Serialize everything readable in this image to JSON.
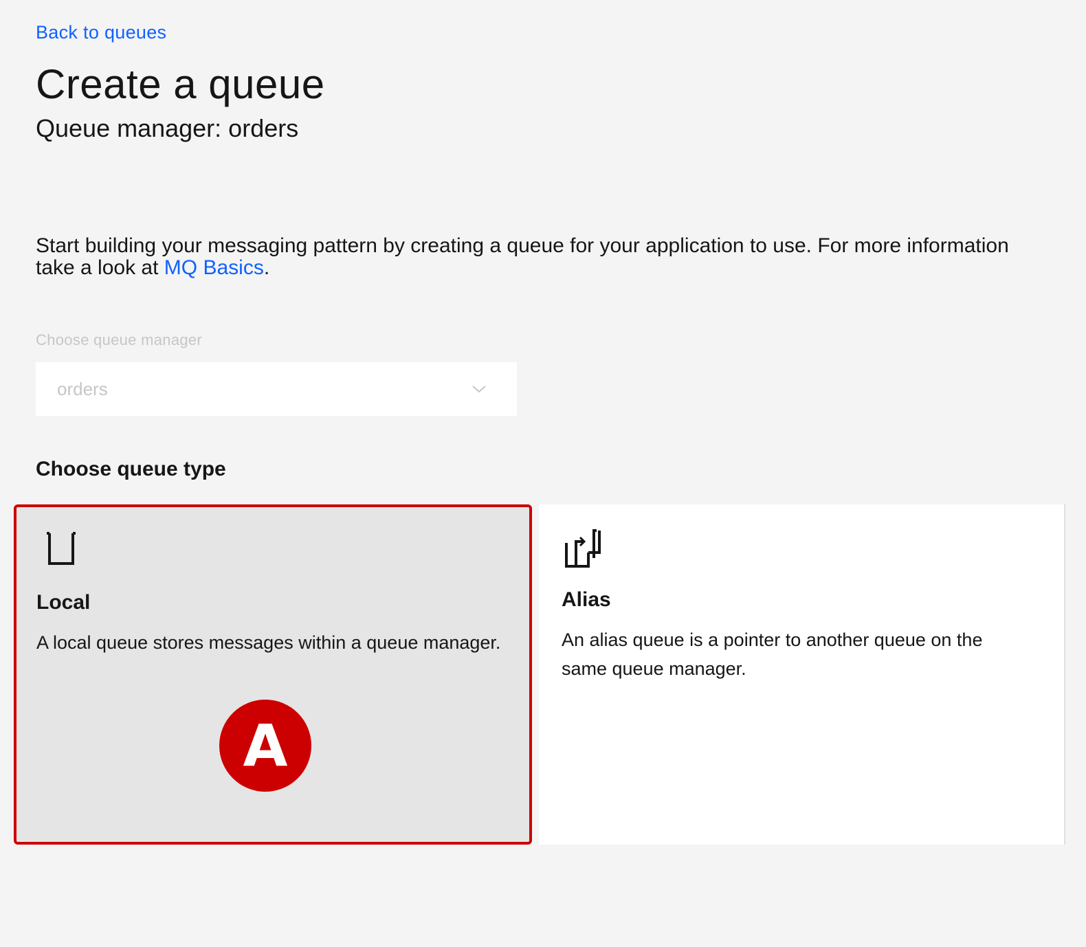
{
  "nav": {
    "back_label": "Back to queues"
  },
  "header": {
    "title": "Create a queue",
    "subtitle": "Queue manager: orders"
  },
  "intro": {
    "text_before": "Start building your messaging pattern by creating a queue for your application to use. For more information take a look at ",
    "link_label": "MQ Basics",
    "text_after": "."
  },
  "queue_manager_select": {
    "label": "Choose queue manager",
    "value": "orders",
    "icon": "chevron-down-icon",
    "disabled": true
  },
  "queue_type": {
    "heading": "Choose queue type",
    "tiles": [
      {
        "title": "Local",
        "description": "A local queue stores messages within a queue manager.",
        "icon": "local-queue-icon",
        "selected": true
      },
      {
        "title": "Alias",
        "description": "An alias queue is a pointer to another queue on the same queue manager.",
        "icon": "alias-queue-icon",
        "selected": false
      }
    ]
  },
  "annotation": {
    "marker_label": "A",
    "color": "#cc0000"
  },
  "colors": {
    "link": "#0f62fe",
    "background": "#f4f4f4",
    "selected_tile_bg": "#e5e5e5",
    "highlight_border": "#cc0000"
  }
}
